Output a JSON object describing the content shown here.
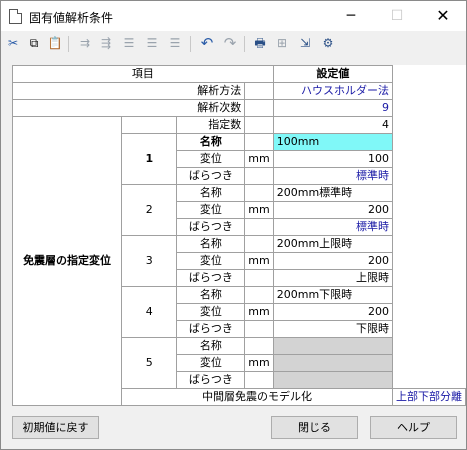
{
  "window": {
    "title": "固有値解析条件",
    "minimize": "─",
    "maximize": "☐",
    "close": "✕"
  },
  "toolbar": [
    {
      "icon": "cut-icon",
      "glyph": "✂"
    },
    {
      "icon": "copy-icon",
      "glyph": "⧉"
    },
    {
      "icon": "paste-icon",
      "glyph": "📋"
    },
    {
      "icon": "insert-row-icon",
      "glyph": "⇉"
    },
    {
      "icon": "delete-row-icon",
      "glyph": "⇶"
    },
    {
      "icon": "align-top-icon",
      "glyph": "☰"
    },
    {
      "icon": "align-middle-icon",
      "glyph": "☰"
    },
    {
      "icon": "align-bottom-icon",
      "glyph": "☰"
    },
    {
      "icon": "undo-icon",
      "glyph": "↶"
    },
    {
      "icon": "redo-icon",
      "glyph": "↷"
    },
    {
      "icon": "print-icon",
      "glyph": "🖶"
    },
    {
      "icon": "print-preview-icon",
      "glyph": "⊞"
    },
    {
      "icon": "export-icon",
      "glyph": "⇲"
    },
    {
      "icon": "settings-icon",
      "glyph": "⚙"
    }
  ],
  "table": {
    "header_item": "項目",
    "header_value": "設定値",
    "method_label": "解析方法",
    "method_value": "ハウスホルダー法",
    "order_label": "解析次数",
    "order_value": "9",
    "group_label": "免震層の指定変位",
    "count_label": "指定数",
    "count_value": "4",
    "name_label": "名称",
    "disp_label": "変位",
    "var_label": "ばらつき",
    "unit": "mm",
    "entries": [
      {
        "no": "1",
        "name": "100mm",
        "disp": "100",
        "var": "標準時"
      },
      {
        "no": "2",
        "name": "200mm標準時",
        "disp": "200",
        "var": "標準時"
      },
      {
        "no": "3",
        "name": "200mm上限時",
        "disp": "200",
        "var": "上限時"
      },
      {
        "no": "4",
        "name": "200mm下限時",
        "disp": "200",
        "var": "下限時"
      },
      {
        "no": "5",
        "name": "",
        "disp": "",
        "var": ""
      }
    ],
    "model_label": "中間層免震のモデル化",
    "model_value": "上部下部分離"
  },
  "buttons": {
    "reset": "初期値に戻す",
    "close": "閉じる",
    "help": "ヘルプ"
  }
}
